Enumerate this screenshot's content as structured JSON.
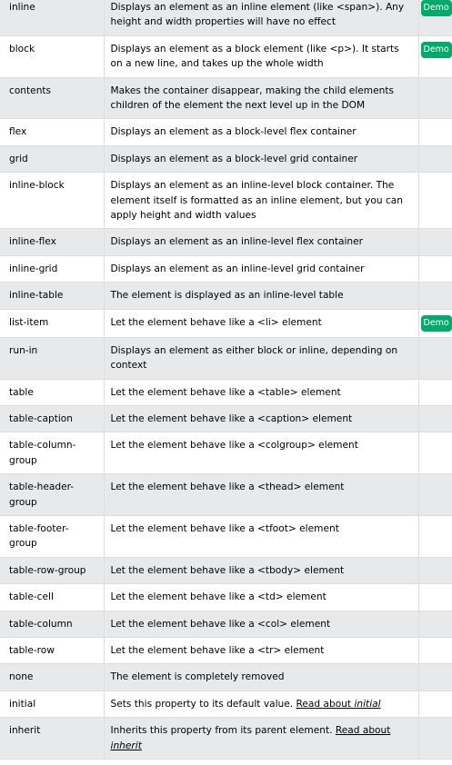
{
  "button_label": "Demo",
  "accent_color": "#04aa6d",
  "rows": [
    {
      "value": "inline",
      "desc": "Displays an element as an inline element (like <span>). Any height and width properties will have no effect",
      "demo": true
    },
    {
      "value": "block",
      "desc": "Displays an element as a block element (like <p>). It starts on a new line, and takes up the whole width",
      "demo": true
    },
    {
      "value": "contents",
      "desc": "Makes the container disappear, making the child elements children of the element the next level up in the DOM",
      "demo": false
    },
    {
      "value": "flex",
      "desc": "Displays an element as a block-level flex container",
      "demo": false
    },
    {
      "value": "grid",
      "desc": "Displays an element as a block-level grid container",
      "demo": false
    },
    {
      "value": "inline-block",
      "desc": "Displays an element as an inline-level block container. The element itself is formatted as an inline element, but you can apply height and width values",
      "demo": false
    },
    {
      "value": "inline-flex",
      "desc": "Displays an element as an inline-level flex container",
      "demo": false
    },
    {
      "value": "inline-grid",
      "desc": "Displays an element as an inline-level grid container",
      "demo": false
    },
    {
      "value": "inline-table",
      "desc": "The element is displayed as an inline-level table",
      "demo": false
    },
    {
      "value": "list-item",
      "desc": "Let the element behave like a <li> element",
      "demo": true
    },
    {
      "value": "run-in",
      "desc": "Displays an element as either block or inline, depending on context",
      "demo": false
    },
    {
      "value": "table",
      "desc": "Let the element behave like a <table> element",
      "demo": false
    },
    {
      "value": "table-caption",
      "desc": "Let the element behave like a <caption> element",
      "demo": false
    },
    {
      "value": "table-column-group",
      "desc": "Let the element behave like a <colgroup> element",
      "demo": false
    },
    {
      "value": "table-header-group",
      "desc": "Let the element behave like a <thead> element",
      "demo": false
    },
    {
      "value": "table-footer-group",
      "desc": "Let the element behave like a <tfoot> element",
      "demo": false
    },
    {
      "value": "table-row-group",
      "desc": "Let the element behave like a <tbody> element",
      "demo": false
    },
    {
      "value": "table-cell",
      "desc": "Let the element behave like a <td> element",
      "demo": false
    },
    {
      "value": "table-column",
      "desc": "Let the element behave like a <col> element",
      "demo": false
    },
    {
      "value": "table-row",
      "desc": "Let the element behave like a <tr> element",
      "demo": false
    },
    {
      "value": "none",
      "desc": "The element is completely removed",
      "demo": false
    },
    {
      "value": "initial",
      "desc": "Sets this property to its default value.",
      "link_prefix": "Read about ",
      "link_em": "initial",
      "demo": false
    },
    {
      "value": "inherit",
      "desc": "Inherits this property from its parent element.",
      "link_prefix": "Read about ",
      "link_em": "inherit",
      "demo": false
    }
  ]
}
